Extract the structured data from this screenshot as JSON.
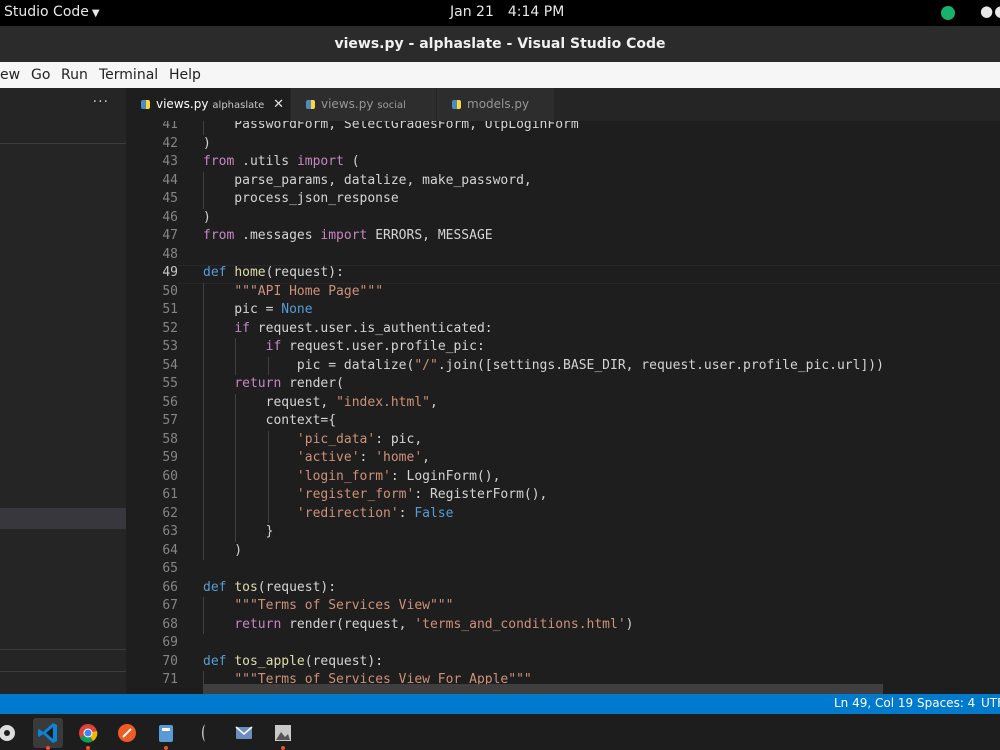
{
  "system_bar": {
    "app_menu": "Studio Code",
    "date": "Jan 21",
    "time": "4:14 PM"
  },
  "window": {
    "title": "views.py - alphaslate - Visual Studio Code"
  },
  "menu": [
    "ew",
    "Go",
    "Run",
    "Terminal",
    "Help"
  ],
  "sidebar": {
    "more_label": "···"
  },
  "tabs": [
    {
      "label": "views.py",
      "desc": "alphaslate",
      "active": true,
      "close": "✕"
    },
    {
      "label": "views.py",
      "desc": "social",
      "active": false
    },
    {
      "label": "models.py",
      "desc": "",
      "active": false
    }
  ],
  "editor": {
    "current_line": 49,
    "lines": [
      {
        "n": 41,
        "code": "    PasswordForm, SelectGradesForm, UtpLoginForm"
      },
      {
        "n": 42,
        "code": ")"
      },
      {
        "n": 43,
        "code": "from .utils import ("
      },
      {
        "n": 44,
        "code": "    parse_params, datalize, make_password,"
      },
      {
        "n": 45,
        "code": "    process_json_response"
      },
      {
        "n": 46,
        "code": ")"
      },
      {
        "n": 47,
        "code": "from .messages import ERRORS, MESSAGE"
      },
      {
        "n": 48,
        "code": ""
      },
      {
        "n": 49,
        "code": "def home(request):"
      },
      {
        "n": 50,
        "code": "    \"\"\"API Home Page\"\"\""
      },
      {
        "n": 51,
        "code": "    pic = None"
      },
      {
        "n": 52,
        "code": "    if request.user.is_authenticated:"
      },
      {
        "n": 53,
        "code": "        if request.user.profile_pic:"
      },
      {
        "n": 54,
        "code": "            pic = datalize(\"/\".join([settings.BASE_DIR, request.user.profile_pic.url]))"
      },
      {
        "n": 55,
        "code": "    return render("
      },
      {
        "n": 56,
        "code": "        request, \"index.html\","
      },
      {
        "n": 57,
        "code": "        context={"
      },
      {
        "n": 58,
        "code": "            'pic_data': pic,"
      },
      {
        "n": 59,
        "code": "            'active': 'home',"
      },
      {
        "n": 60,
        "code": "            'login_form': LoginForm(),"
      },
      {
        "n": 61,
        "code": "            'register_form': RegisterForm(),"
      },
      {
        "n": 62,
        "code": "            'redirection': False"
      },
      {
        "n": 63,
        "code": "        }"
      },
      {
        "n": 64,
        "code": "    )"
      },
      {
        "n": 65,
        "code": ""
      },
      {
        "n": 66,
        "code": "def tos(request):"
      },
      {
        "n": 67,
        "code": "    \"\"\"Terms of Services View\"\"\""
      },
      {
        "n": 68,
        "code": "    return render(request, 'terms_and_conditions.html')"
      },
      {
        "n": 69,
        "code": ""
      },
      {
        "n": 70,
        "code": "def tos_apple(request):"
      },
      {
        "n": 71,
        "code": "    \"\"\"Terms of Services View For Apple\"\"\""
      }
    ]
  },
  "status_bar": {
    "position": "Ln 49, Col 19",
    "spaces": "Spaces: 4",
    "encoding": "UTF"
  },
  "dock": [
    "settings-app-icon",
    "vscode-icon",
    "chrome-icon",
    "postman-icon",
    "files-icon",
    "inkscape-icon",
    "mail-icon",
    "image-viewer-icon"
  ],
  "colors": {
    "status_bar": "#007acc",
    "editor_bg": "#1e1e1e",
    "keyword": "#c586c0",
    "declaration": "#569cd6",
    "function": "#dcdcaa",
    "string": "#ce9178",
    "variable": "#9cdcfe"
  }
}
